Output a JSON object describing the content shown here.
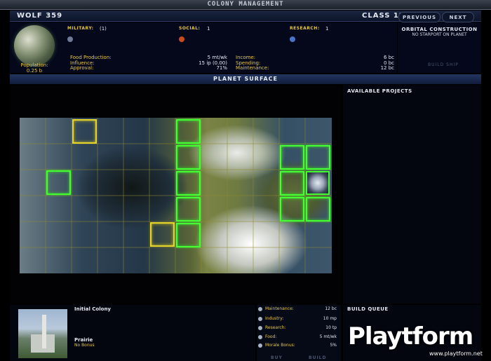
{
  "window": {
    "title": "Colony Management"
  },
  "header": {
    "system_name": "Wolf 359",
    "planet_class": "Class 12"
  },
  "nav": {
    "previous_label": "Previous",
    "next_label": "Next"
  },
  "stats": {
    "military_label": "Military:",
    "military_value": "(1)",
    "social_label": "Social:",
    "social_value": "1",
    "research_label": "Research:",
    "research_value": "1"
  },
  "population": {
    "label": "Population:",
    "value": "0.25 b"
  },
  "economy": {
    "left": [
      {
        "label": "Food Production:",
        "value": "5 mt/wk"
      },
      {
        "label": "Influence:",
        "value": "15 ip (0.00)"
      },
      {
        "label": "Approval:",
        "value": "71%"
      }
    ],
    "right": [
      {
        "label": "Income:",
        "value": "6 bc"
      },
      {
        "label": "Spending:",
        "value": "0 bc"
      },
      {
        "label": "Maintenance:",
        "value": "12 bc"
      }
    ]
  },
  "orbital": {
    "title": "Orbital Construction",
    "status": "No starport on planet",
    "build_ship_label": "Build Ship"
  },
  "surface": {
    "title": "Planet Surface"
  },
  "projects": {
    "title": "Available Projects"
  },
  "colony": {
    "name": "Initial Colony",
    "terrain": "Prairie",
    "bonus": "No Bonus"
  },
  "metrics": [
    {
      "label": "Maintenance:",
      "value": "12 bc",
      "icon": "maintenance-icon"
    },
    {
      "label": "Industry:",
      "value": "10 mp",
      "icon": "industry-icon"
    },
    {
      "label": "Research:",
      "value": "10 tp",
      "icon": "research-icon"
    },
    {
      "label": "Food:",
      "value": "5 mt/wk",
      "icon": "food-icon"
    },
    {
      "label": "Morale Bonus:",
      "value": "5%",
      "icon": "morale-icon"
    }
  ],
  "actions": {
    "buy_label": "Buy",
    "build_label": "Build"
  },
  "queue": {
    "title": "Build Queue"
  },
  "watermark": {
    "brand": "Playtform",
    "url": "www.playtform.net"
  },
  "colors": {
    "accent_yellow": "#e8c840",
    "tile_green": "#45ff35",
    "tile_yellow": "#e6d52a",
    "panel_blue": "#111c3a"
  }
}
